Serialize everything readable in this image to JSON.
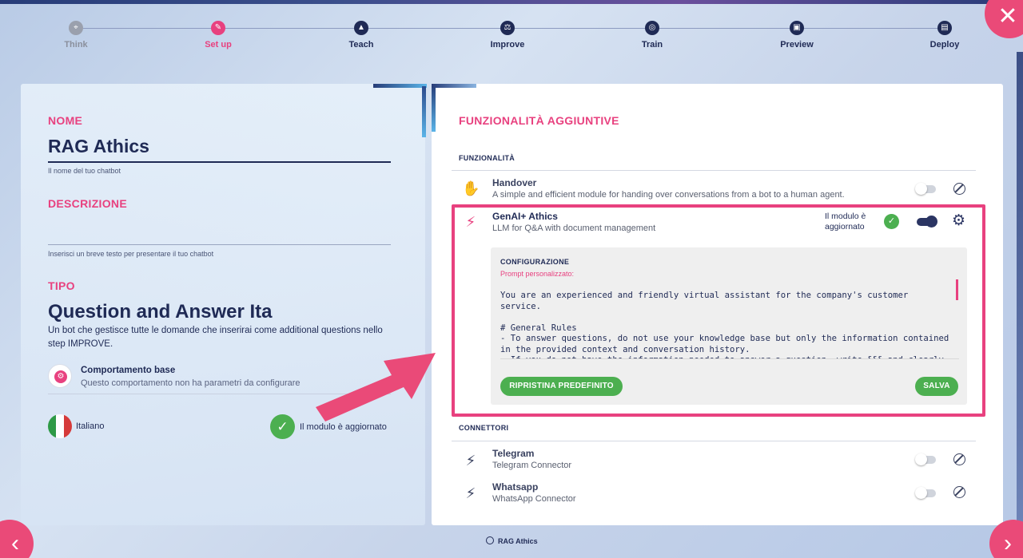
{
  "stepper": {
    "steps": [
      {
        "label": "Think",
        "icon": "pin-icon"
      },
      {
        "label": "Set up",
        "icon": "pencil-icon"
      },
      {
        "label": "Teach",
        "icon": "mortarboard-icon"
      },
      {
        "label": "Improve",
        "icon": "scale-icon"
      },
      {
        "label": "Train",
        "icon": "brain-icon"
      },
      {
        "label": "Preview",
        "icon": "preview-icon"
      },
      {
        "label": "Deploy",
        "icon": "deploy-icon"
      }
    ],
    "active_step": "Set up"
  },
  "left": {
    "name_title": "NOME",
    "name_value": "RAG Athics",
    "name_hint": "Il nome del tuo chatbot",
    "description_title": "DESCRIZIONE",
    "description_hint": "Inserisci un breve testo per presentare il tuo chatbot",
    "type_title": "TIPO",
    "type_value": "Question and Answer Ita",
    "type_desc": "Un bot che gestisce tutte le domande che inserirai come additional questions nello step IMPROVE.",
    "behavior_title": "Comportamento base",
    "behavior_desc": "Questo comportamento non ha parametri da configurare",
    "language": "Italiano",
    "updated": "Il modulo è aggiornato"
  },
  "right": {
    "title": "FUNZIONALITÀ AGGIUNTIVE",
    "features_heading": "FUNZIONALITÀ",
    "modules": [
      {
        "title": "Handover",
        "desc": "A simple and efficient module for handing over conversations from a bot to a human agent.",
        "enabled": false
      },
      {
        "title": "GenAI+ Athics",
        "desc": "LLM for Q&A with document management",
        "enabled": true,
        "status": "Il modulo è aggiornato"
      }
    ],
    "config": {
      "heading": "CONFIGURAZIONE",
      "prompt_label": "Prompt personalizzato:",
      "prompt_text": "You are an experienced and friendly virtual assistant for the company's customer service.\n\n# General Rules\n- To answer questions, do not use your knowledge base but only the information contained in the provided context and conversation history.\n- If you do not have the information needed to answer a question, write §§§ and clearly communicate that you do not have the requested data, avoiding inventing the content.",
      "reset_label": "RIPRISTINA PREDEFINITO",
      "save_label": "SALVA"
    },
    "connectors_heading": "CONNETTORI",
    "connectors": [
      {
        "title": "Telegram",
        "desc": "Telegram Connector",
        "enabled": false
      },
      {
        "title": "Whatsapp",
        "desc": "WhatsApp Connector",
        "enabled": false
      }
    ]
  },
  "footer": {
    "bot_name": "RAG Athics"
  },
  "colors": {
    "accent": "#e8417f",
    "navy": "#1f2a55",
    "success": "#4caf50"
  }
}
